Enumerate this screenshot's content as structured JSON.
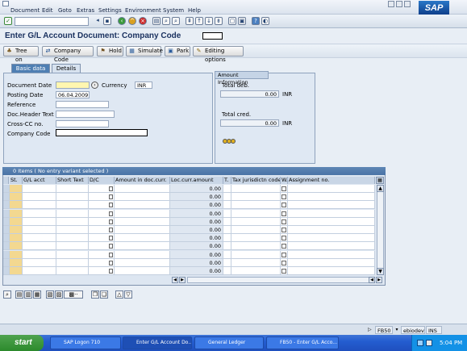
{
  "menu": {
    "items": [
      "Document",
      "Edit",
      "Goto",
      "Extras",
      "Settings",
      "Environment",
      "System",
      "Help"
    ]
  },
  "logo": "SAP",
  "title": "Enter G/L Account Document: Company Code",
  "app_toolbar": {
    "tree_on": "Tree on",
    "company_code": "Company Code",
    "hold": "Hold",
    "simulate": "Simulate",
    "park": "Park",
    "editing_options": "Editing options"
  },
  "tabs": {
    "basic": "Basic data",
    "details": "Details"
  },
  "basic": {
    "document_date_label": "Document Date",
    "currency_label": "Currency",
    "currency_value": "INR",
    "posting_date_label": "Posting Date",
    "posting_date_value": "06.04.2009",
    "reference_label": "Reference",
    "doc_header_label": "Doc.Header Text",
    "cross_cc_label": "Cross-CC no.",
    "company_code_label": "Company Code"
  },
  "amount": {
    "title": "Amount Information",
    "total_deb_label": "Total deb.",
    "total_deb_value": "0.00",
    "total_deb_currency": "INR",
    "total_cred_label": "Total cred.",
    "total_cred_value": "0.00",
    "total_cred_currency": "INR"
  },
  "grid": {
    "title": "0 Items ( No entry variant selected )",
    "columns": [
      "St.",
      "G/L acct",
      "Short Text",
      "D/C",
      "Amount in doc.curr.",
      "Loc.curr.amount",
      "T.",
      "Tax jurisdictn code",
      "W.",
      "Assignment no."
    ],
    "row_loc_amount": "0.00",
    "row_count": 11
  },
  "status": {
    "transaction": "FB50",
    "server": "ebiodev",
    "mode": "INS"
  },
  "taskbar": {
    "start": "start",
    "tasks": [
      "SAP Logon 710",
      "Enter G/L Account Do...",
      "General Ledger",
      "FB50 - Enter G/L Acco..."
    ],
    "clock": "5:04 PM"
  }
}
